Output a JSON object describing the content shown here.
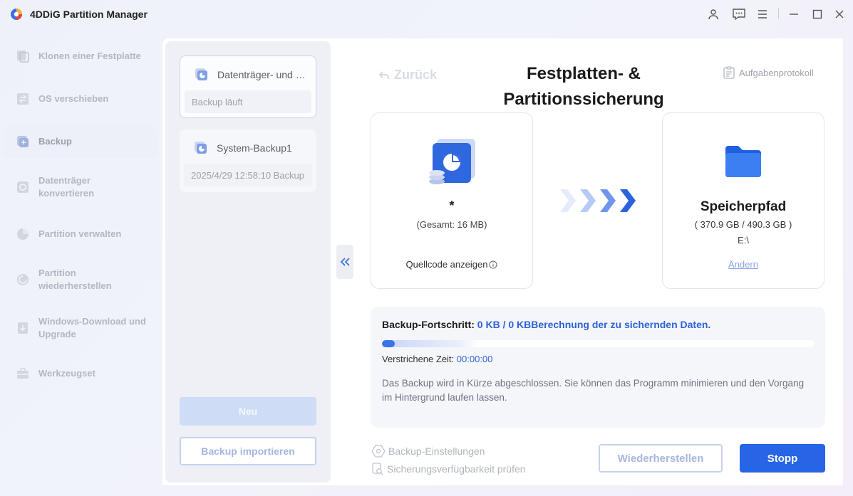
{
  "app": {
    "title": "4DDiG Partition Manager"
  },
  "window_controls": [
    "user-icon",
    "feedback-icon",
    "menu-icon",
    "minimize-icon",
    "maximize-icon",
    "close-icon"
  ],
  "nav": {
    "items": [
      {
        "label": "Klonen einer Festplatte",
        "icon": "clone-disk-icon",
        "active": false
      },
      {
        "label": "OS verschieben",
        "icon": "migrate-os-icon",
        "active": false
      },
      {
        "label": "Backup",
        "icon": "backup-icon",
        "active": true
      },
      {
        "label": "Datenträger konvertieren",
        "icon": "convert-disk-icon",
        "active": false
      },
      {
        "label": "Partition verwalten",
        "icon": "pie-icon",
        "active": false
      },
      {
        "label": "Partition wiederherstellen",
        "icon": "recover-partition-icon",
        "active": false
      },
      {
        "label": "Windows-Download und Upgrade",
        "icon": "windows-download-icon",
        "active": false
      },
      {
        "label": "Werkzeugset",
        "icon": "toolbox-icon",
        "active": false
      }
    ]
  },
  "tasks": [
    {
      "title": "Datenträger- und Partitionssicherung",
      "status": "Backup läuft",
      "active": true
    },
    {
      "title": "System-Backup1",
      "status": "2025/4/29 12:58:10 Backup",
      "active": false
    }
  ],
  "buttons": {
    "new": "Neu",
    "import": "Backup importieren",
    "restore": "Wiederherstellen",
    "stop": "Stopp"
  },
  "header": {
    "back": "Zurück",
    "title": "Festplatten- & Partitionssicherung",
    "log": "Aufgabenprotokoll"
  },
  "source": {
    "name": "*",
    "total": "(Gesamt: 16 MB)",
    "show_source": "Quellcode anzeigen"
  },
  "destination": {
    "title": "Speicherpfad",
    "capacity": "( 370.9 GB / 490.3 GB )",
    "path": "E:\\",
    "change": "Ändern"
  },
  "progress": {
    "label": "Backup-Fortschritt:",
    "value": "0 KB / 0 KBBerechnung der zu sichernden Daten.",
    "percent": 0,
    "elapsed_label": "Verstrichene Zeit:",
    "elapsed_value": "00:00:00",
    "note": "Das Backup wird in Kürze abgeschlossen. Sie können das Programm minimieren und den Vorgang im Hintergrund laufen lassen."
  },
  "options": {
    "settings": "Backup-Einstellungen",
    "check": "Sicherungsverfügbarkeit prüfen"
  },
  "colors": {
    "accent": "#2764e6",
    "progress_text": "#2e62d9",
    "nav_text": "#b3b7c2"
  }
}
